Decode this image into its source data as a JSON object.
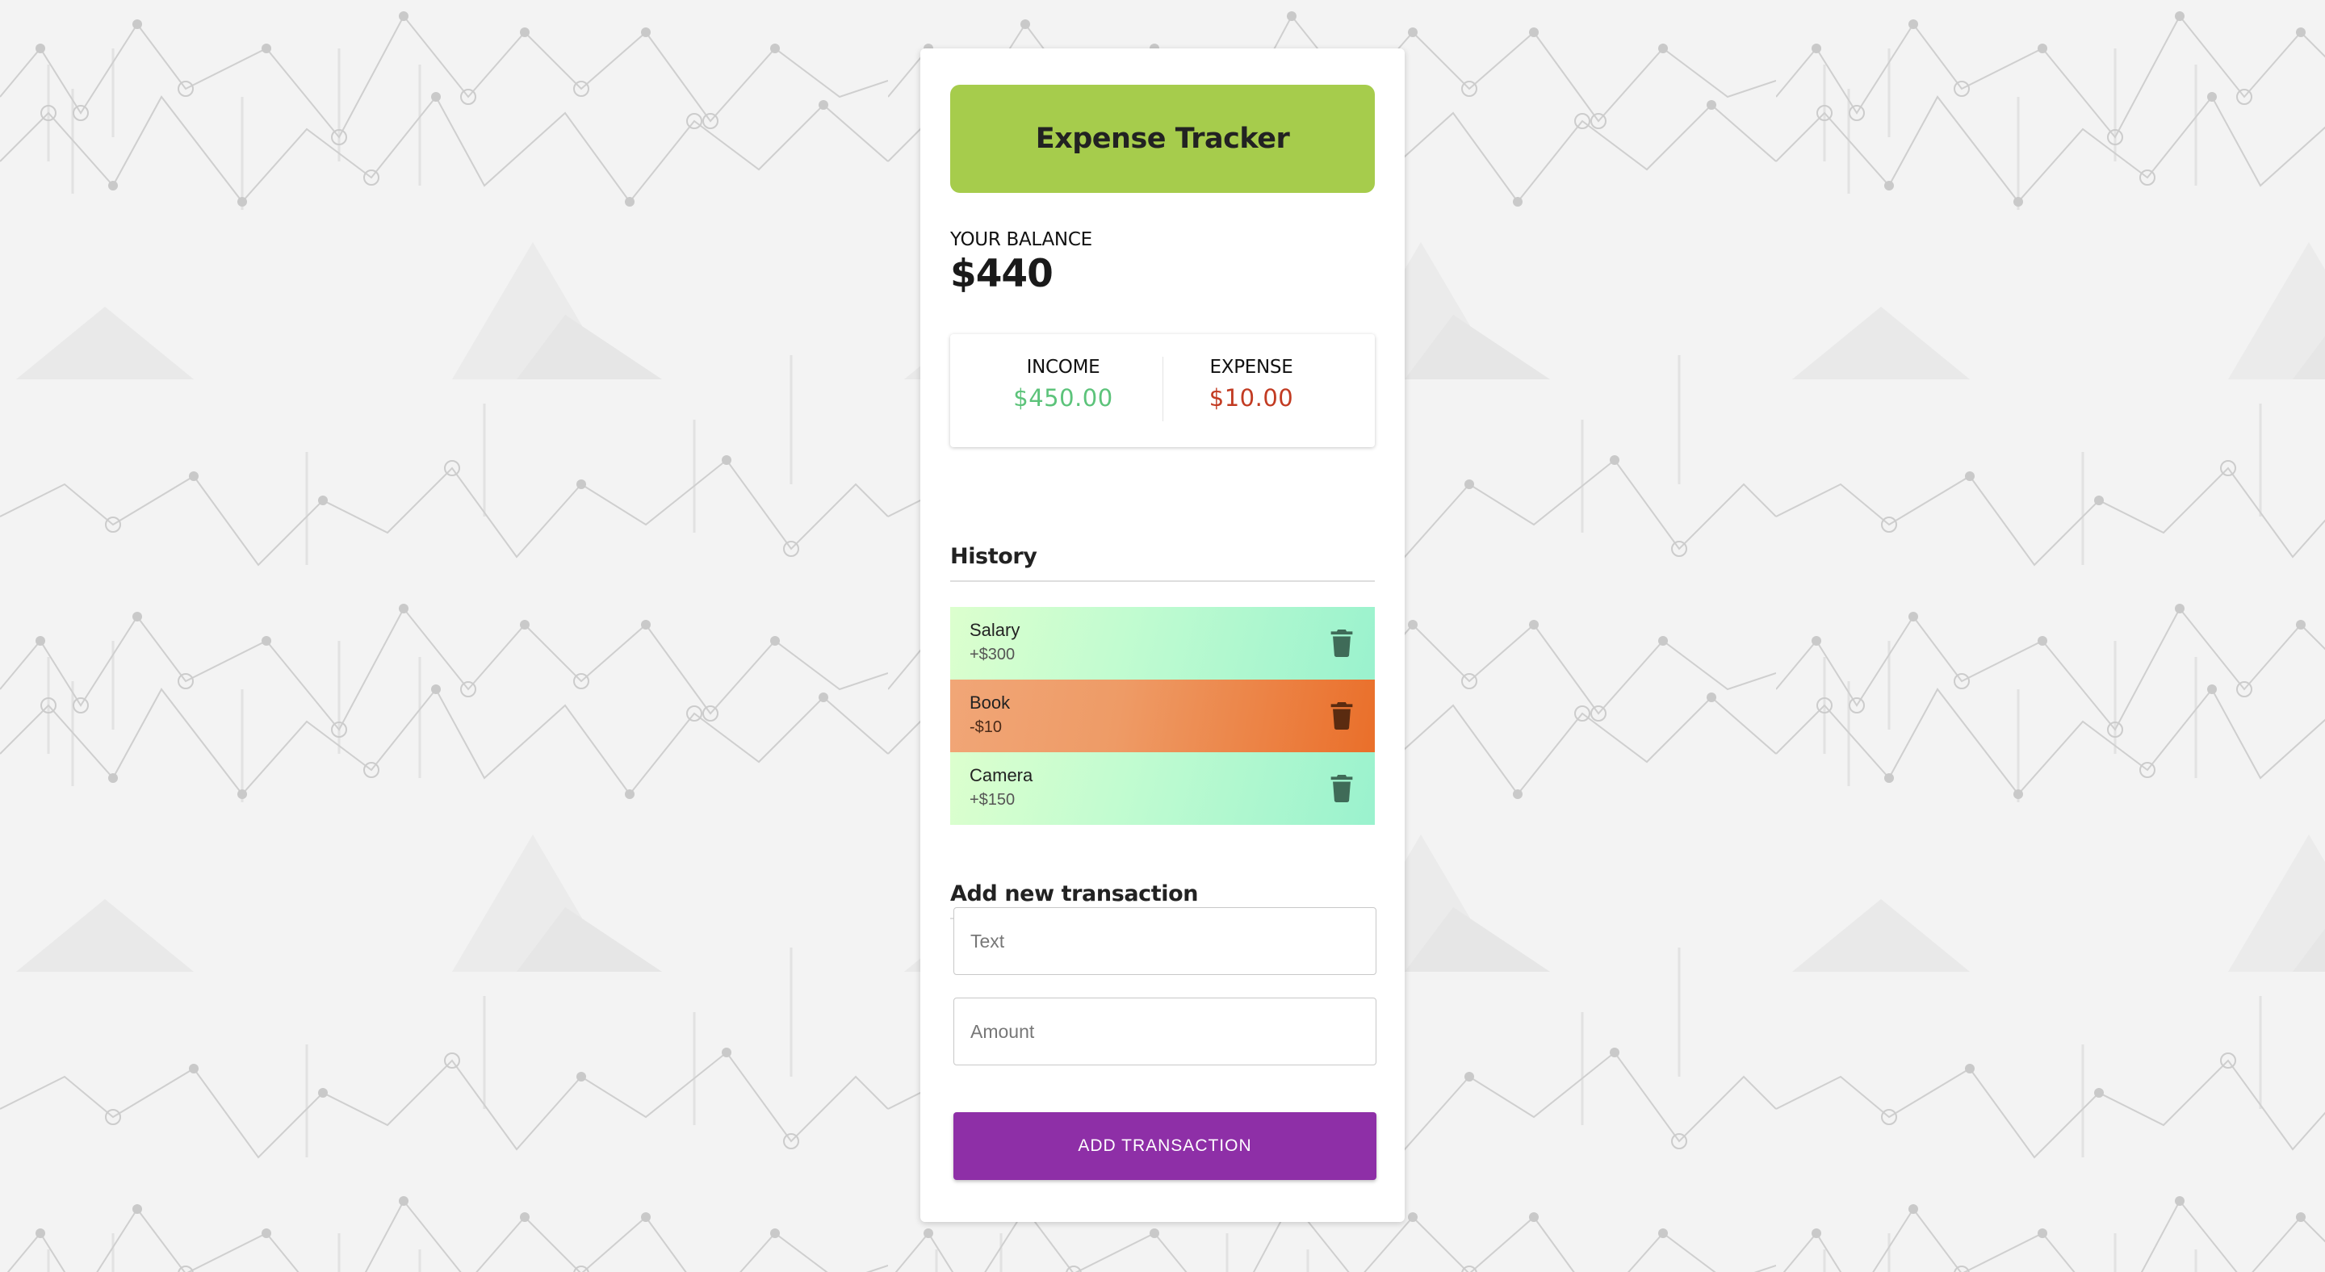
{
  "header": {
    "title": "Expense Tracker"
  },
  "balance": {
    "label": "YOUR BALANCE",
    "value": "$440"
  },
  "summary": {
    "income_label": "INCOME",
    "income_value": "$450.00",
    "expense_label": "EXPENSE",
    "expense_value": "$10.00"
  },
  "history": {
    "title": "History",
    "items": [
      {
        "name": "Salary",
        "amount": "+$300",
        "type": "income"
      },
      {
        "name": "Book",
        "amount": "-$10",
        "type": "expense"
      },
      {
        "name": "Camera",
        "amount": "+$150",
        "type": "income"
      }
    ]
  },
  "form": {
    "title": "Add new transaction",
    "text_placeholder": "Text",
    "amount_placeholder": "Amount",
    "submit_label": "ADD TRANSACTION"
  },
  "icons": {
    "delete": "trash-icon"
  },
  "colors": {
    "header_bg": "#a6cc4c",
    "income": "#5cc37a",
    "expense": "#c23b22",
    "button": "#8e2fa7"
  }
}
